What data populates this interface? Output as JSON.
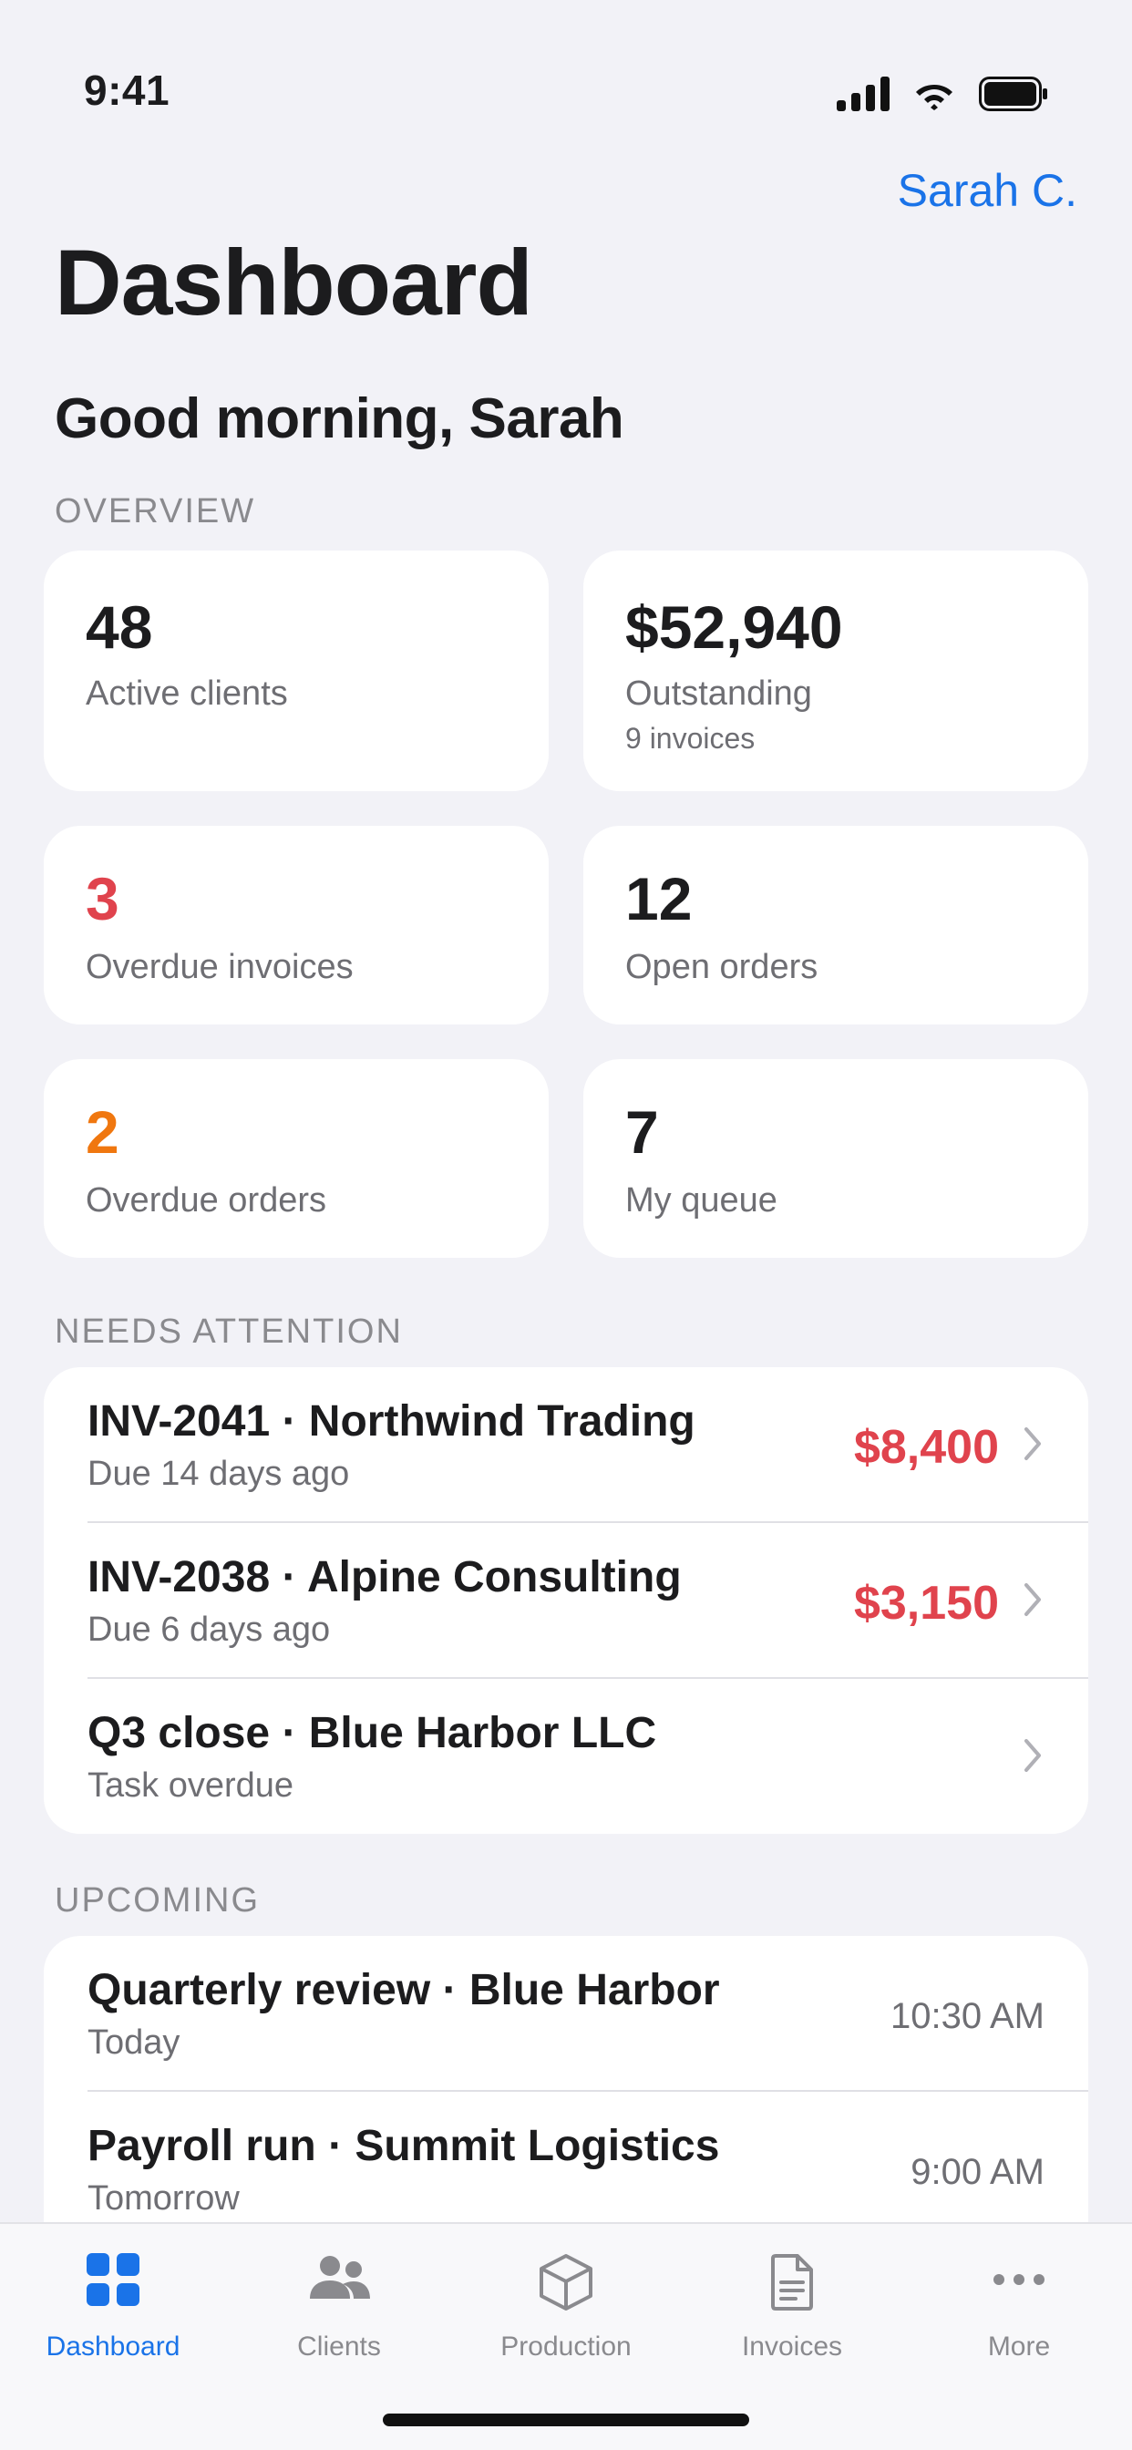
{
  "status_bar": {
    "time": "9:41"
  },
  "header": {
    "account_name": "Sarah C.",
    "title": "Dashboard",
    "greeting": "Good morning, Sarah"
  },
  "overview": {
    "section_label": "OVERVIEW",
    "stats": [
      {
        "value": "48",
        "label": "Active clients",
        "sub": ""
      },
      {
        "value": "$52,940",
        "label": "Outstanding",
        "sub": "9 invoices"
      },
      {
        "value": "3",
        "label": "Overdue invoices",
        "sub": "",
        "color": "#e0434d"
      },
      {
        "value": "12",
        "label": "Open orders",
        "sub": ""
      },
      {
        "value": "2",
        "label": "Overdue orders",
        "sub": "",
        "color": "#f0770f"
      },
      {
        "value": "7",
        "label": "My queue",
        "sub": ""
      }
    ]
  },
  "needs_attention": {
    "section_label": "NEEDS ATTENTION",
    "items": [
      {
        "title": "INV-2041 · Northwind Trading",
        "subtitle": "Due 14 days ago",
        "amount": "$8,400"
      },
      {
        "title": "INV-2038 · Alpine Consulting",
        "subtitle": "Due 6 days ago",
        "amount": "$3,150"
      },
      {
        "title": "Q3 close · Blue Harbor LLC",
        "subtitle": "Task overdue",
        "amount": ""
      }
    ]
  },
  "upcoming": {
    "section_label": "UPCOMING",
    "items": [
      {
        "title": "Quarterly review · Blue Harbor",
        "subtitle": "Today",
        "time": "10:30 AM"
      },
      {
        "title": "Payroll run · Summit Logistics",
        "subtitle": "Tomorrow",
        "time": "9:00 AM"
      }
    ]
  },
  "tab_bar": {
    "tabs": [
      {
        "label": "Dashboard",
        "icon": "grid-icon",
        "active": true
      },
      {
        "label": "Clients",
        "icon": "people-icon",
        "active": false
      },
      {
        "label": "Production",
        "icon": "box-icon",
        "active": false
      },
      {
        "label": "Invoices",
        "icon": "document-icon",
        "active": false
      },
      {
        "label": "More",
        "icon": "ellipsis-icon",
        "active": false
      }
    ]
  },
  "colors": {
    "accent": "#1a73e8",
    "danger": "#e0434d",
    "warning": "#f0770f",
    "background": "#f2f2f7"
  }
}
